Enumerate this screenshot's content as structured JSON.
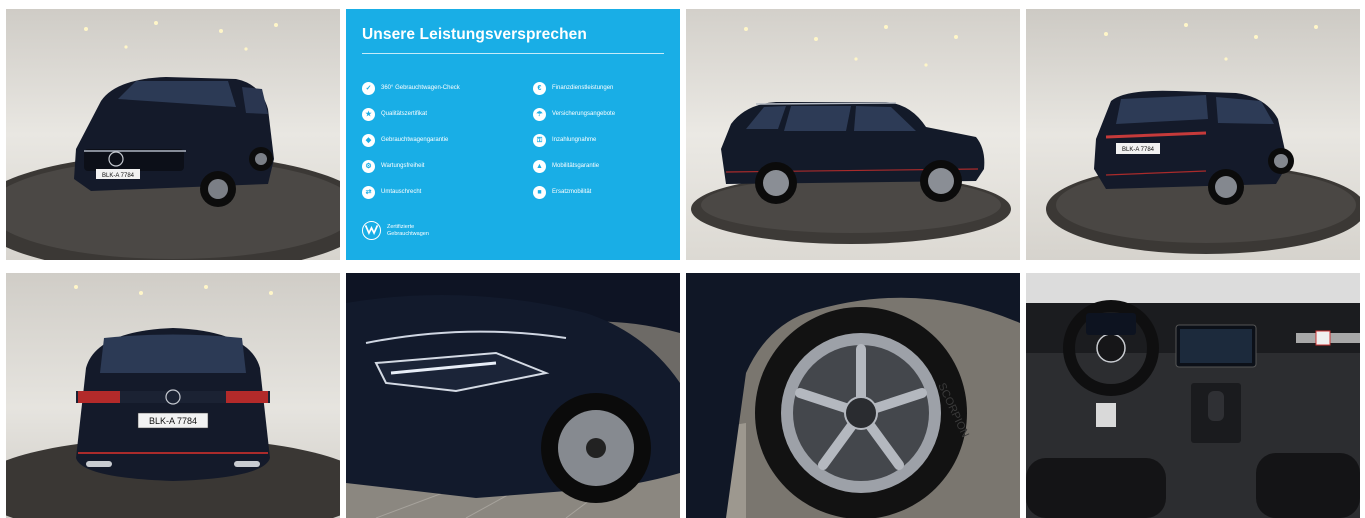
{
  "gallery": {
    "tiles": [
      {
        "name": "photo-front-three-quarter",
        "plate": "BLK-A 7784"
      },
      {
        "name": "promise-card"
      },
      {
        "name": "photo-side-profile"
      },
      {
        "name": "photo-rear-three-quarter"
      },
      {
        "name": "photo-rear",
        "plate": "BLK-A 7784"
      },
      {
        "name": "photo-headlight-detail"
      },
      {
        "name": "photo-wheel-detail",
        "tire_text": "SCORPION"
      },
      {
        "name": "photo-interior-cockpit"
      }
    ]
  },
  "promise": {
    "title": "Unsere Leistungsversprechen",
    "left_items": [
      {
        "label": "360° Gebrauchtwagen-Check",
        "icon": "check-icon"
      },
      {
        "label": "Qualitätszertifikat",
        "icon": "certificate-icon"
      },
      {
        "label": "Gebrauchtwagengarantie",
        "icon": "shield-icon"
      },
      {
        "label": "Wartungsfreiheit",
        "icon": "wrench-icon"
      },
      {
        "label": "Umtauschrecht",
        "icon": "exchange-icon"
      }
    ],
    "right_items": [
      {
        "label": "Finanzdienstleistungen",
        "icon": "money-icon"
      },
      {
        "label": "Versicherungsangebote",
        "icon": "umbrella-icon"
      },
      {
        "label": "Inzahlungnahme",
        "icon": "car-key-icon"
      },
      {
        "label": "Mobilitätsgarantie",
        "icon": "road-icon"
      },
      {
        "label": "Ersatzmobilität",
        "icon": "car-icon"
      }
    ],
    "brand_line1": "Zertifizierte",
    "brand_line2": "Gebrauchtwagen"
  },
  "colors": {
    "promise_bg": "#19aee6",
    "car_paint": "#121828",
    "showroom_wall": "#e6e4df",
    "turntable": "#3a3836"
  }
}
